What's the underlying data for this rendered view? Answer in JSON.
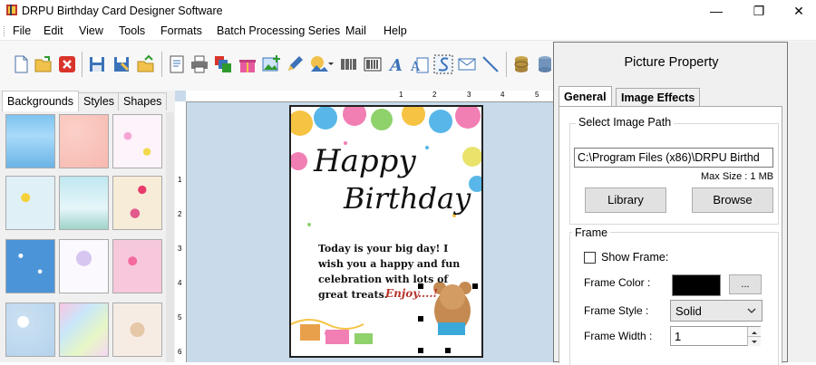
{
  "window": {
    "title": "DRPU Birthday Card Designer Software",
    "minimize_glyph": "—",
    "restore_glyph": "❐",
    "close_glyph": "✕"
  },
  "menu": [
    "File",
    "Edit",
    "View",
    "Tools",
    "Formats",
    "Batch Processing Series",
    "Mail",
    "Help"
  ],
  "toolbar": {
    "icons": [
      "new-icon",
      "open-icon",
      "close-doc-icon",
      "save-icon",
      "save-as-icon",
      "export-icon",
      "properties-icon",
      "print-icon",
      "layers-icon",
      "gift-icon",
      "add-image-icon",
      "pen-icon",
      "shape-icon",
      "barcode-icon",
      "barcode-2d-icon",
      "text-icon",
      "text-box-icon",
      "signature-icon",
      "mail-icon",
      "line-icon",
      "database-icon",
      "database-2-icon"
    ]
  },
  "left_panel": {
    "tabs": [
      "Backgrounds",
      "Styles",
      "Shapes"
    ],
    "active_tab": "Backgrounds",
    "thumbnails": [
      "Clouds",
      "Pink roses",
      "Butterflies",
      "Flowers",
      "Winter scene",
      "Balloons bird",
      "Stars",
      "Balloons sketch",
      "Pink hearts",
      "Bubbles",
      "Pastel rainbow",
      "Teddy bear"
    ]
  },
  "ruler": {
    "top_numbers": [
      "1",
      "2",
      "3",
      "4",
      "5"
    ],
    "left_numbers": [
      "1",
      "2",
      "3",
      "4",
      "5",
      "6"
    ]
  },
  "card": {
    "headline_1": "Happy",
    "headline_2": "Birthday",
    "message_lines": [
      "Today is your big day! I",
      "wish you a happy and fun",
      "celebration with lots of",
      "great treats."
    ],
    "signoff": "Enjoy....!"
  },
  "property_panel": {
    "title": "Picture Property",
    "tabs": [
      "General",
      "Image Effects"
    ],
    "active_tab": "General",
    "image_path_group": "Select Image Path",
    "image_path_value": "C:\\Program Files (x86)\\DRPU Birthd",
    "max_size": "Max Size : 1 MB",
    "library_button": "Library",
    "browse_button": "Browse",
    "frame_group": "Frame",
    "show_frame_label": "Show Frame:",
    "show_frame_checked": false,
    "frame_color_label": "Frame Color :",
    "frame_color_value": "#000000",
    "frame_color_button": "...",
    "frame_style_label": "Frame Style :",
    "frame_style_value": "Solid",
    "frame_width_label": "Frame Width :",
    "frame_width_value": "1"
  },
  "colors": {
    "canvas_bg": "#c9dbea",
    "panel_bg": "#f0f0f0",
    "button_bg": "#e1e1e1"
  }
}
